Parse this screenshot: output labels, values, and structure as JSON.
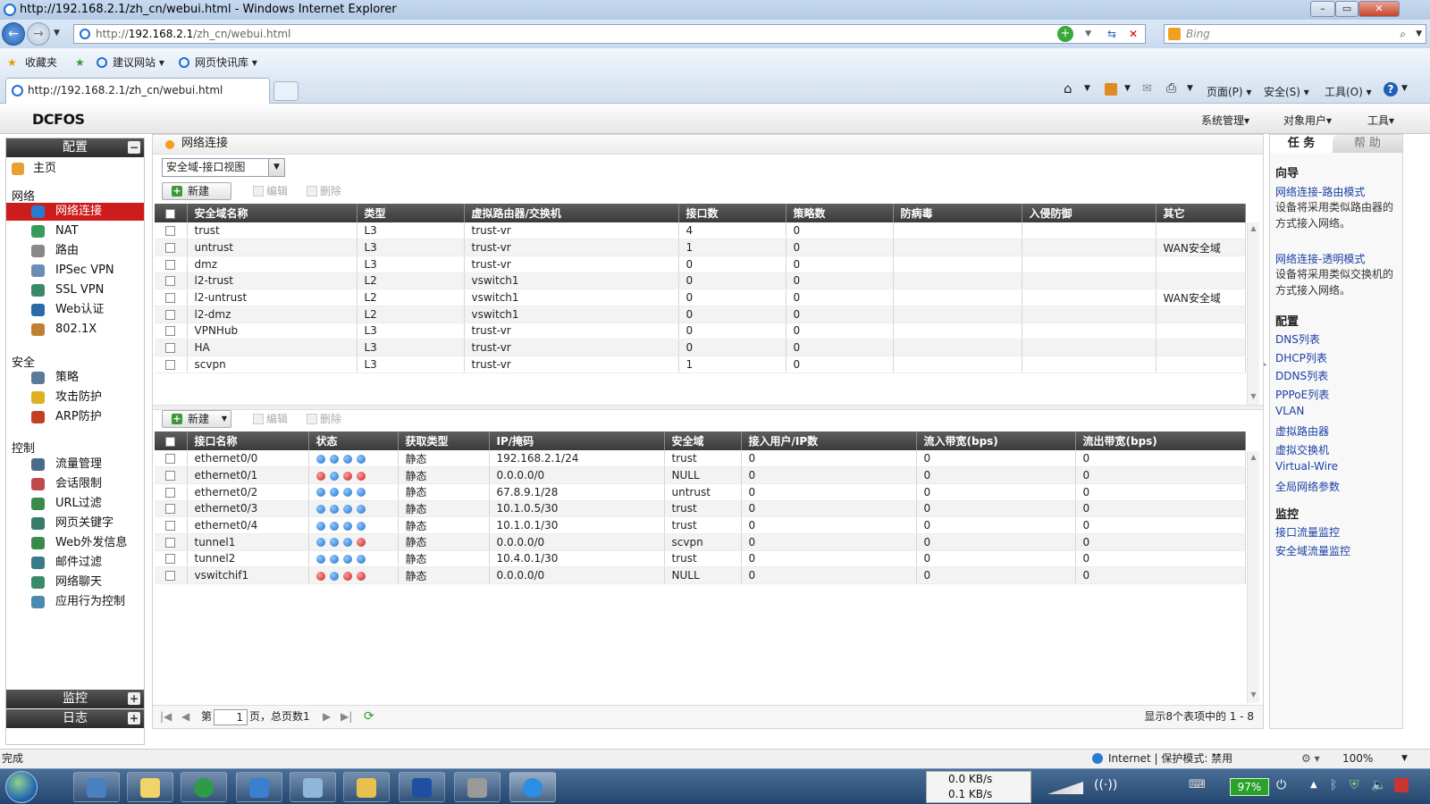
{
  "browser": {
    "title": "http://192.168.2.1/zh_cn/webui.html - Windows Internet Explorer",
    "address_prefix": "http://",
    "address_host": "192.168.2.1",
    "address_path": "/zh_cn/webui.html",
    "search_placeholder": "Bing",
    "favorites_label": "收藏夹",
    "fav_items": [
      "建议网站 ▾",
      "网页快讯库 ▾"
    ],
    "tab_title": "http://192.168.2.1/zh_cn/webui.html",
    "command_items": [
      "页面(P) ▾",
      "安全(S) ▾",
      "工具(O) ▾"
    ],
    "status_left": "完成",
    "status_zone": "Internet | 保护模式: 禁用",
    "zoom": "100%"
  },
  "app": {
    "logo": "DCFOS",
    "top_menu": [
      "系统管理▾",
      "对象用户▾",
      "工具▾"
    ]
  },
  "sidebar": {
    "config_label": "配置",
    "home_label": "主页",
    "group_network": "网络",
    "network_items": [
      "网络连接",
      "NAT",
      "路由",
      "IPSec VPN",
      "SSL VPN",
      "Web认证",
      "802.1X"
    ],
    "group_security": "安全",
    "security_items": [
      "策略",
      "攻击防护",
      "ARP防护"
    ],
    "group_control": "控制",
    "control_items": [
      "流量管理",
      "会话限制",
      "URL过滤",
      "网页关键字",
      "Web外发信息",
      "邮件过滤",
      "网络聊天",
      "应用行为控制"
    ],
    "monitor_label": "监控",
    "log_label": "日志"
  },
  "main": {
    "breadcrumb": "网络连接",
    "view_select": "安全域-接口视图",
    "btn_new": "新建",
    "btn_edit": "编辑",
    "btn_delete": "删除",
    "zones": {
      "headers": [
        "安全域名称",
        "类型",
        "虚拟路由器/交换机",
        "接口数",
        "策略数",
        "防病毒",
        "入侵防御",
        "其它"
      ],
      "rows": [
        [
          "trust",
          "L3",
          "trust-vr",
          "4",
          "0",
          "",
          "",
          ""
        ],
        [
          "untrust",
          "L3",
          "trust-vr",
          "1",
          "0",
          "",
          "",
          "WAN安全域"
        ],
        [
          "dmz",
          "L3",
          "trust-vr",
          "0",
          "0",
          "",
          "",
          ""
        ],
        [
          "l2-trust",
          "L2",
          "vswitch1",
          "0",
          "0",
          "",
          "",
          ""
        ],
        [
          "l2-untrust",
          "L2",
          "vswitch1",
          "0",
          "0",
          "",
          "",
          "WAN安全域"
        ],
        [
          "l2-dmz",
          "L2",
          "vswitch1",
          "0",
          "0",
          "",
          "",
          ""
        ],
        [
          "VPNHub",
          "L3",
          "trust-vr",
          "0",
          "0",
          "",
          "",
          ""
        ],
        [
          "HA",
          "L3",
          "trust-vr",
          "0",
          "0",
          "",
          "",
          ""
        ],
        [
          "scvpn",
          "L3",
          "trust-vr",
          "1",
          "0",
          "",
          "",
          ""
        ]
      ]
    },
    "interfaces": {
      "headers": [
        "接口名称",
        "状态",
        "获取类型",
        "IP/掩码",
        "安全域",
        "接入用户/IP数",
        "流入带宽(bps)",
        "流出带宽(bps)"
      ],
      "rows": [
        {
          "name": "ethernet0/0",
          "status": [
            "ok",
            "ok",
            "ok",
            "ok"
          ],
          "type": "静态",
          "ip": "192.168.2.1/24",
          "zone": "trust",
          "users": "0",
          "in": "0",
          "out": "0"
        },
        {
          "name": "ethernet0/1",
          "status": [
            "bad",
            "ok",
            "bad",
            "bad"
          ],
          "type": "静态",
          "ip": "0.0.0.0/0",
          "zone": "NULL",
          "users": "0",
          "in": "0",
          "out": "0"
        },
        {
          "name": "ethernet0/2",
          "status": [
            "ok",
            "ok",
            "ok",
            "ok"
          ],
          "type": "静态",
          "ip": "67.8.9.1/28",
          "zone": "untrust",
          "users": "0",
          "in": "0",
          "out": "0"
        },
        {
          "name": "ethernet0/3",
          "status": [
            "ok",
            "ok",
            "ok",
            "ok"
          ],
          "type": "静态",
          "ip": "10.1.0.5/30",
          "zone": "trust",
          "users": "0",
          "in": "0",
          "out": "0"
        },
        {
          "name": "ethernet0/4",
          "status": [
            "ok",
            "ok",
            "ok",
            "ok"
          ],
          "type": "静态",
          "ip": "10.1.0.1/30",
          "zone": "trust",
          "users": "0",
          "in": "0",
          "out": "0"
        },
        {
          "name": "tunnel1",
          "status": [
            "ok",
            "ok",
            "ok",
            "bad"
          ],
          "type": "静态",
          "ip": "0.0.0.0/0",
          "zone": "scvpn",
          "users": "0",
          "in": "0",
          "out": "0"
        },
        {
          "name": "tunnel2",
          "status": [
            "ok",
            "ok",
            "ok",
            "ok"
          ],
          "type": "静态",
          "ip": "10.4.0.1/30",
          "zone": "trust",
          "users": "0",
          "in": "0",
          "out": "0"
        },
        {
          "name": "vswitchif1",
          "status": [
            "bad",
            "ok",
            "bad",
            "bad"
          ],
          "type": "静态",
          "ip": "0.0.0.0/0",
          "zone": "NULL",
          "users": "0",
          "in": "0",
          "out": "0"
        }
      ]
    },
    "pager": {
      "page_prefix": "第",
      "page_value": "1",
      "page_suffix": "页，总页数1",
      "summary": "显示8个表项中的 1 - 8"
    }
  },
  "right_panel": {
    "tab_task": "任 务",
    "tab_help": "帮 助",
    "wizard_title": "向导",
    "wizard_links": [
      {
        "label": "网络连接-路由模式",
        "desc": "设备将采用类似路由器的方式接入网络。"
      },
      {
        "label": "网络连接-透明模式",
        "desc": "设备将采用类似交换机的方式接入网络。"
      }
    ],
    "config_title": "配置",
    "config_links": [
      "DNS列表",
      "DHCP列表",
      "DDNS列表",
      "PPPoE列表",
      "VLAN",
      "虚拟路由器",
      "虚拟交换机",
      "Virtual-Wire",
      "全局网络参数"
    ],
    "monitor_title": "监控",
    "monitor_links": [
      "接口流量监控",
      "安全域流量监控"
    ]
  },
  "taskbar": {
    "net_down": "0.0 KB/s",
    "net_up": "0.1 KB/s",
    "battery": "97%"
  },
  "colors": {
    "accent_red": "#cc1c1c",
    "link_blue": "#1a3fa3",
    "header_dark": "#3a3a3a"
  }
}
